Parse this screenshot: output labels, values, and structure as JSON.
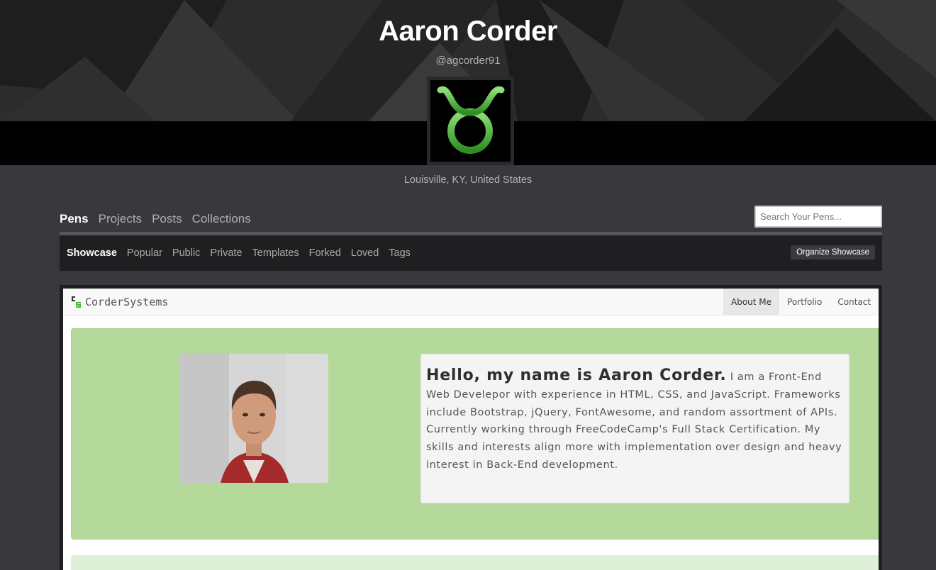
{
  "profile": {
    "name": "Aaron Corder",
    "handle": "@agcorder91",
    "location": "Louisville, KY, United States",
    "avatar_icon": "taurus-icon",
    "accent_color": "#47b833"
  },
  "main_tabs": [
    {
      "label": "Pens",
      "active": true
    },
    {
      "label": "Projects"
    },
    {
      "label": "Posts"
    },
    {
      "label": "Collections"
    }
  ],
  "search": {
    "placeholder": "Search Your Pens..."
  },
  "sub_tabs": [
    {
      "label": "Showcase",
      "active": true
    },
    {
      "label": "Popular"
    },
    {
      "label": "Public"
    },
    {
      "label": "Private"
    },
    {
      "label": "Templates"
    },
    {
      "label": "Forked"
    },
    {
      "label": "Loved"
    },
    {
      "label": "Tags"
    }
  ],
  "organize_label": "Organize Showcase",
  "preview": {
    "brand": "CorderSystems",
    "nav_links": [
      "About Me",
      "Portfolio",
      "Contact"
    ],
    "bio_greeting": "Hello, my name is Aaron Corder.",
    "bio_text": "I am a Front-End Web Develepor with experience in HTML, CSS, and JavaScript. Frameworks include Bootstrap, jQuery, FontAwesome, and random assortment of APIs. Currently working through FreeCodeCamp's Full Stack Certification. My skills and interests align more with implementation over design and heavy interest in Back-End development.",
    "jumbotron_color": "#b5d99a"
  }
}
